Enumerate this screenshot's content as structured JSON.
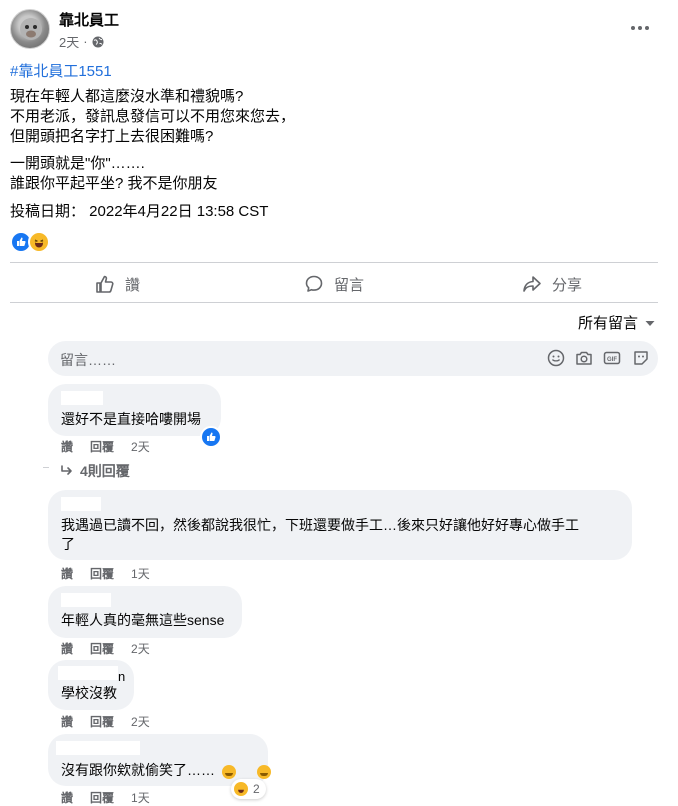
{
  "post": {
    "author": "靠北員工",
    "time": "2天",
    "hashtag": "#靠北員工1551",
    "lines": [
      "現在年輕人都這麼沒水準和禮貌嗎?",
      "不用老派，發訊息發信可以不用您來您去，",
      "但開頭把名字打上去很困難嗎?",
      "一開頭就是\"你\"…….",
      "誰跟你平起平坐? 我不是你朋友",
      "投稿日期：  2022年4月22日 13:58 CST"
    ]
  },
  "actions": {
    "like": "讚",
    "comment": "留言",
    "share": "分享"
  },
  "comments_sort": "所有留言",
  "comment_input": {
    "placeholder": "留言……"
  },
  "comments": [
    {
      "text": "還好不是直接哈嘍開場",
      "like": "讚",
      "reply": "回覆",
      "time": "2天"
    },
    {
      "text_line1": "我遇過已讀不回，然後都說我很忙，下班還要做手工…後來只好讓他好好專心做手工",
      "text_line2": "了",
      "like": "讚",
      "reply": "回覆",
      "time": "1天"
    },
    {
      "text": "年輕人真的毫無這些sense",
      "like": "讚",
      "reply": "回覆",
      "time": "2天"
    },
    {
      "name_fragment": "n",
      "text": "學校沒教",
      "like": "讚",
      "reply": "回覆",
      "time": "2天"
    },
    {
      "text": "沒有跟你欸就偷笑了……",
      "like": "讚",
      "reply": "回覆",
      "time": "1天",
      "reaction_count": "2"
    }
  ],
  "replies_link": "4則回覆",
  "colors": {
    "link": "#216fdb",
    "secondary_text": "#65676b",
    "bubble": "#f0f2f5",
    "like_blue": "#1877f2",
    "haha_yellow": "#f7b928"
  }
}
